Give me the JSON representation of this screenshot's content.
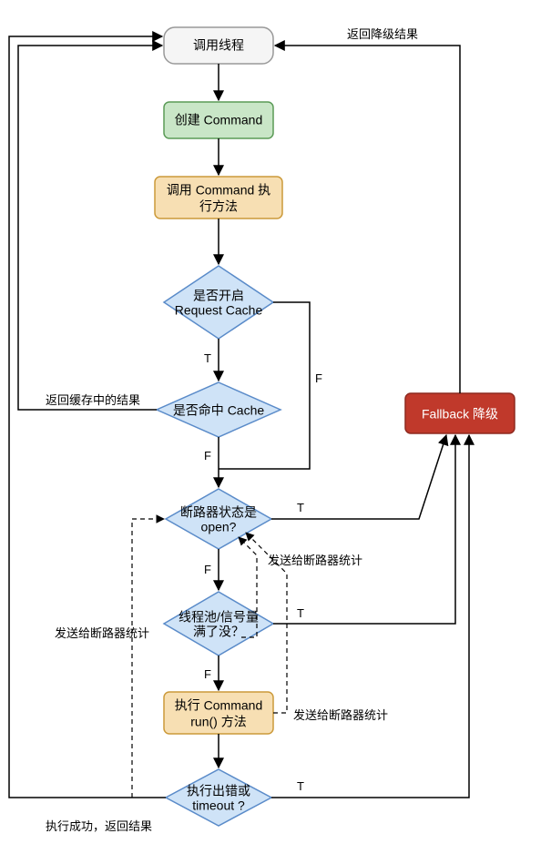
{
  "nodes": {
    "start": "调用线程",
    "create": "创建 Command",
    "invoke_l1": "调用 Command 执",
    "invoke_l2": "行方法",
    "cacheEnabled_l1": "是否开启",
    "cacheEnabled_l2": "Request Cache",
    "cacheHit": "是否命中 Cache",
    "circuit_l1": "断路器状态是",
    "circuit_l2": "open?",
    "pool_l1": "线程池/信号量",
    "pool_l2": "满了没？",
    "run_l1": "执行 Command",
    "run_l2": "run() 方法",
    "error_l1": "执行出错或",
    "error_l2": "timeout ?",
    "fallback": "Fallback 降级"
  },
  "edges": {
    "returnFallback": "返回降级结果",
    "cacheHitReturn": "返回缓存中的结果",
    "stats1": "发送给断路器统计",
    "stats2": "发送给断路器统计",
    "stats3": "发送给断路器统计",
    "successReturn": "执行成功，返回结果",
    "T": "T",
    "F": "F"
  }
}
